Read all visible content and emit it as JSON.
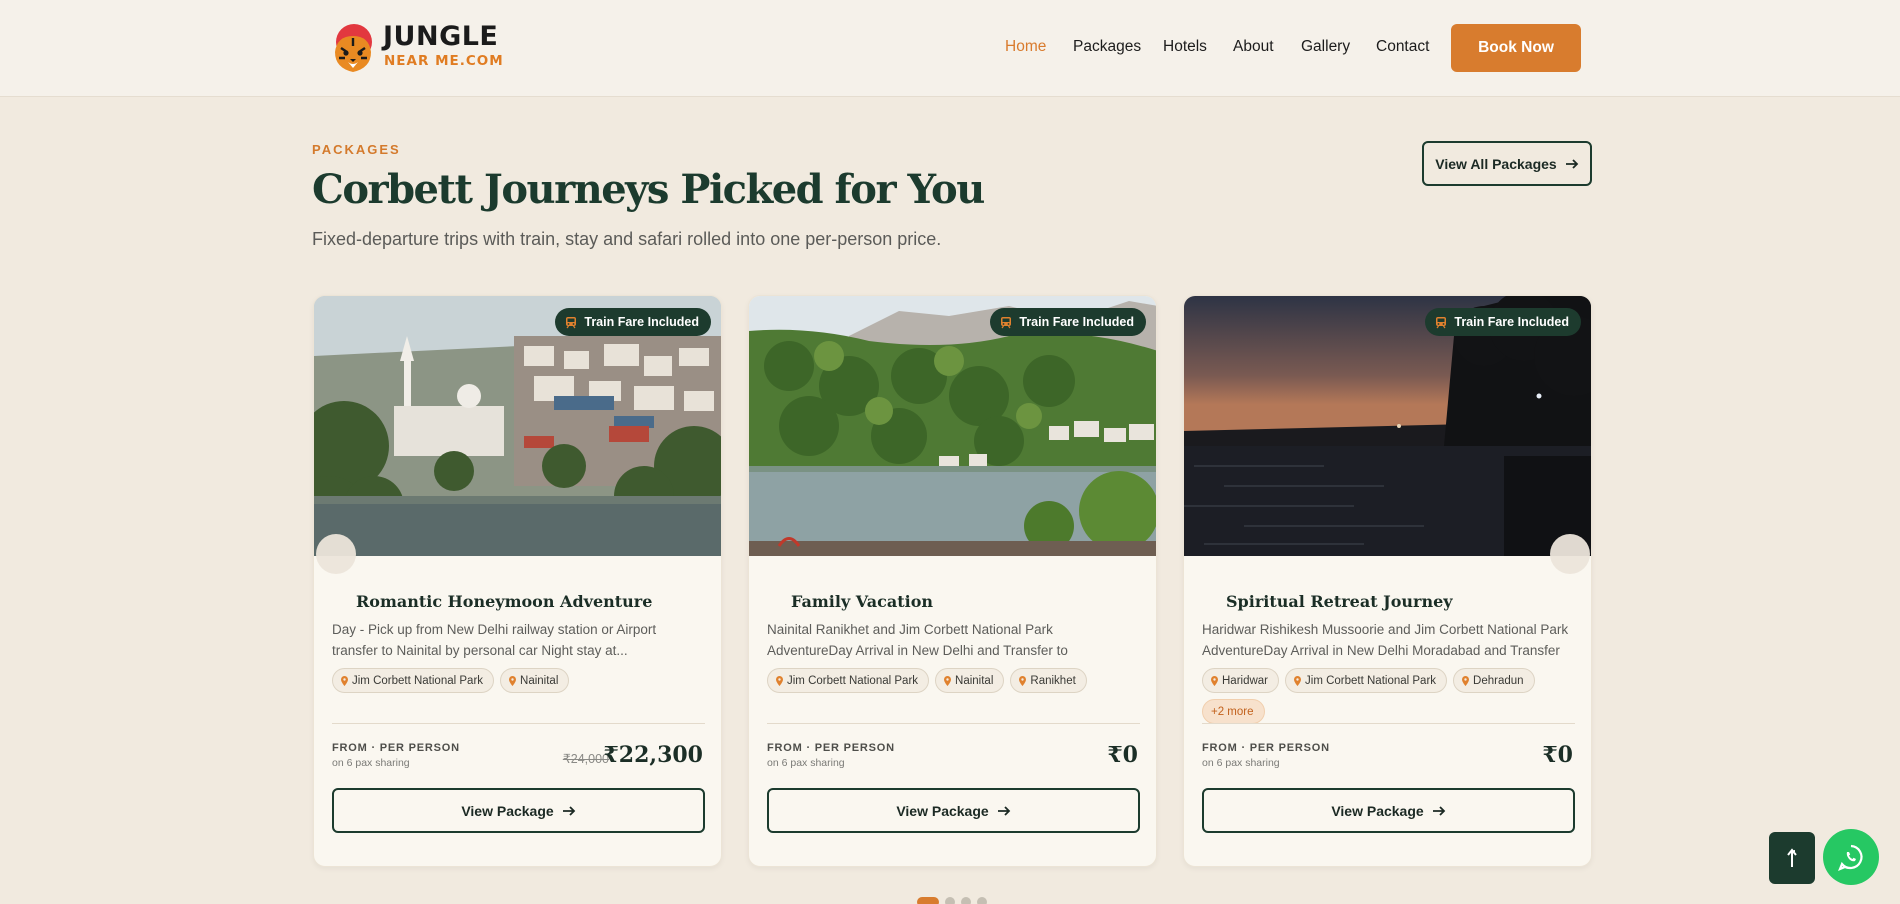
{
  "brand": {
    "line1": "JUNGLE",
    "line2": "NEAR ME.COM",
    "accent_color": "#d87c2e",
    "dark_color": "#1c3b2e"
  },
  "nav": {
    "items": [
      "Home",
      "Packages",
      "Hotels",
      "About",
      "Gallery",
      "Contact"
    ],
    "active": "Home",
    "cta": "Book Now"
  },
  "section": {
    "eyebrow": "PACKAGES",
    "title": "Corbett Journeys Picked for You",
    "subtitle": "Fixed-departure trips with train, stay and safari rolled into one per-person price.",
    "view_all": "View All Packages"
  },
  "cards": [
    {
      "badge": "Train Fare Included",
      "name": "Romantic Honeymoon Adventure",
      "description": "Day - Pick up from New Delhi railway station or Airport transfer to Nainital by personal car Night stay at...",
      "tags": [
        "Jim Corbett National Park",
        "Nainital"
      ],
      "more": "",
      "from_label": "FROM · PER PERSON",
      "sharing": "on 6 pax sharing",
      "old_price": "₹24,000",
      "price": "₹22,300",
      "button": "View Package"
    },
    {
      "badge": "Train Fare Included",
      "name": "Family Vacation",
      "description": "Nainital Ranikhet and Jim Corbett National Park AdventureDay Arrival in New Delhi and Transfer to NainitalPickup Location...",
      "tags": [
        "Jim Corbett National Park",
        "Nainital",
        "Ranikhet"
      ],
      "more": "",
      "from_label": "FROM · PER PERSON",
      "sharing": "on 6 pax sharing",
      "old_price": "",
      "price": "₹0",
      "button": "View Package"
    },
    {
      "badge": "Train Fare Included",
      "name": "Spiritual Retreat Journey",
      "description": "Haridwar Rishikesh Mussoorie and Jim Corbett National Park AdventureDay Arrival in New Delhi Moradabad and Transfer t...",
      "tags": [
        "Haridwar",
        "Jim Corbett National Park",
        "Dehradun"
      ],
      "more": "+2 more",
      "from_label": "FROM · PER PERSON",
      "sharing": "on 6 pax sharing",
      "old_price": "",
      "price": "₹0",
      "button": "View Package"
    }
  ],
  "carousel": {
    "pages": 4,
    "active_page": 1
  },
  "floating": {
    "scroll_top_icon": "arrow-up-icon",
    "whatsapp_icon": "whatsapp-icon"
  }
}
